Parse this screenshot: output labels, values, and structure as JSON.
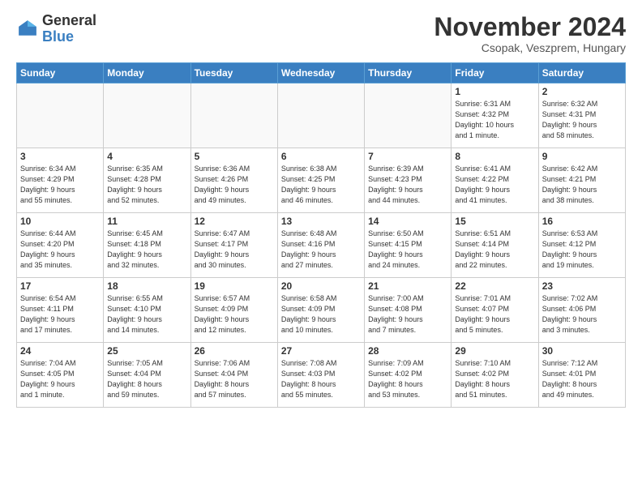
{
  "header": {
    "logo": {
      "general": "General",
      "blue": "Blue"
    },
    "title": "November 2024",
    "location": "Csopak, Veszprem, Hungary"
  },
  "weekdays": [
    "Sunday",
    "Monday",
    "Tuesday",
    "Wednesday",
    "Thursday",
    "Friday",
    "Saturday"
  ],
  "weeks": [
    [
      {
        "day": "",
        "info": ""
      },
      {
        "day": "",
        "info": ""
      },
      {
        "day": "",
        "info": ""
      },
      {
        "day": "",
        "info": ""
      },
      {
        "day": "",
        "info": ""
      },
      {
        "day": "1",
        "info": "Sunrise: 6:31 AM\nSunset: 4:32 PM\nDaylight: 10 hours\nand 1 minute."
      },
      {
        "day": "2",
        "info": "Sunrise: 6:32 AM\nSunset: 4:31 PM\nDaylight: 9 hours\nand 58 minutes."
      }
    ],
    [
      {
        "day": "3",
        "info": "Sunrise: 6:34 AM\nSunset: 4:29 PM\nDaylight: 9 hours\nand 55 minutes."
      },
      {
        "day": "4",
        "info": "Sunrise: 6:35 AM\nSunset: 4:28 PM\nDaylight: 9 hours\nand 52 minutes."
      },
      {
        "day": "5",
        "info": "Sunrise: 6:36 AM\nSunset: 4:26 PM\nDaylight: 9 hours\nand 49 minutes."
      },
      {
        "day": "6",
        "info": "Sunrise: 6:38 AM\nSunset: 4:25 PM\nDaylight: 9 hours\nand 46 minutes."
      },
      {
        "day": "7",
        "info": "Sunrise: 6:39 AM\nSunset: 4:23 PM\nDaylight: 9 hours\nand 44 minutes."
      },
      {
        "day": "8",
        "info": "Sunrise: 6:41 AM\nSunset: 4:22 PM\nDaylight: 9 hours\nand 41 minutes."
      },
      {
        "day": "9",
        "info": "Sunrise: 6:42 AM\nSunset: 4:21 PM\nDaylight: 9 hours\nand 38 minutes."
      }
    ],
    [
      {
        "day": "10",
        "info": "Sunrise: 6:44 AM\nSunset: 4:20 PM\nDaylight: 9 hours\nand 35 minutes."
      },
      {
        "day": "11",
        "info": "Sunrise: 6:45 AM\nSunset: 4:18 PM\nDaylight: 9 hours\nand 32 minutes."
      },
      {
        "day": "12",
        "info": "Sunrise: 6:47 AM\nSunset: 4:17 PM\nDaylight: 9 hours\nand 30 minutes."
      },
      {
        "day": "13",
        "info": "Sunrise: 6:48 AM\nSunset: 4:16 PM\nDaylight: 9 hours\nand 27 minutes."
      },
      {
        "day": "14",
        "info": "Sunrise: 6:50 AM\nSunset: 4:15 PM\nDaylight: 9 hours\nand 24 minutes."
      },
      {
        "day": "15",
        "info": "Sunrise: 6:51 AM\nSunset: 4:14 PM\nDaylight: 9 hours\nand 22 minutes."
      },
      {
        "day": "16",
        "info": "Sunrise: 6:53 AM\nSunset: 4:12 PM\nDaylight: 9 hours\nand 19 minutes."
      }
    ],
    [
      {
        "day": "17",
        "info": "Sunrise: 6:54 AM\nSunset: 4:11 PM\nDaylight: 9 hours\nand 17 minutes."
      },
      {
        "day": "18",
        "info": "Sunrise: 6:55 AM\nSunset: 4:10 PM\nDaylight: 9 hours\nand 14 minutes."
      },
      {
        "day": "19",
        "info": "Sunrise: 6:57 AM\nSunset: 4:09 PM\nDaylight: 9 hours\nand 12 minutes."
      },
      {
        "day": "20",
        "info": "Sunrise: 6:58 AM\nSunset: 4:09 PM\nDaylight: 9 hours\nand 10 minutes."
      },
      {
        "day": "21",
        "info": "Sunrise: 7:00 AM\nSunset: 4:08 PM\nDaylight: 9 hours\nand 7 minutes."
      },
      {
        "day": "22",
        "info": "Sunrise: 7:01 AM\nSunset: 4:07 PM\nDaylight: 9 hours\nand 5 minutes."
      },
      {
        "day": "23",
        "info": "Sunrise: 7:02 AM\nSunset: 4:06 PM\nDaylight: 9 hours\nand 3 minutes."
      }
    ],
    [
      {
        "day": "24",
        "info": "Sunrise: 7:04 AM\nSunset: 4:05 PM\nDaylight: 9 hours\nand 1 minute."
      },
      {
        "day": "25",
        "info": "Sunrise: 7:05 AM\nSunset: 4:04 PM\nDaylight: 8 hours\nand 59 minutes."
      },
      {
        "day": "26",
        "info": "Sunrise: 7:06 AM\nSunset: 4:04 PM\nDaylight: 8 hours\nand 57 minutes."
      },
      {
        "day": "27",
        "info": "Sunrise: 7:08 AM\nSunset: 4:03 PM\nDaylight: 8 hours\nand 55 minutes."
      },
      {
        "day": "28",
        "info": "Sunrise: 7:09 AM\nSunset: 4:02 PM\nDaylight: 8 hours\nand 53 minutes."
      },
      {
        "day": "29",
        "info": "Sunrise: 7:10 AM\nSunset: 4:02 PM\nDaylight: 8 hours\nand 51 minutes."
      },
      {
        "day": "30",
        "info": "Sunrise: 7:12 AM\nSunset: 4:01 PM\nDaylight: 8 hours\nand 49 minutes."
      }
    ]
  ]
}
